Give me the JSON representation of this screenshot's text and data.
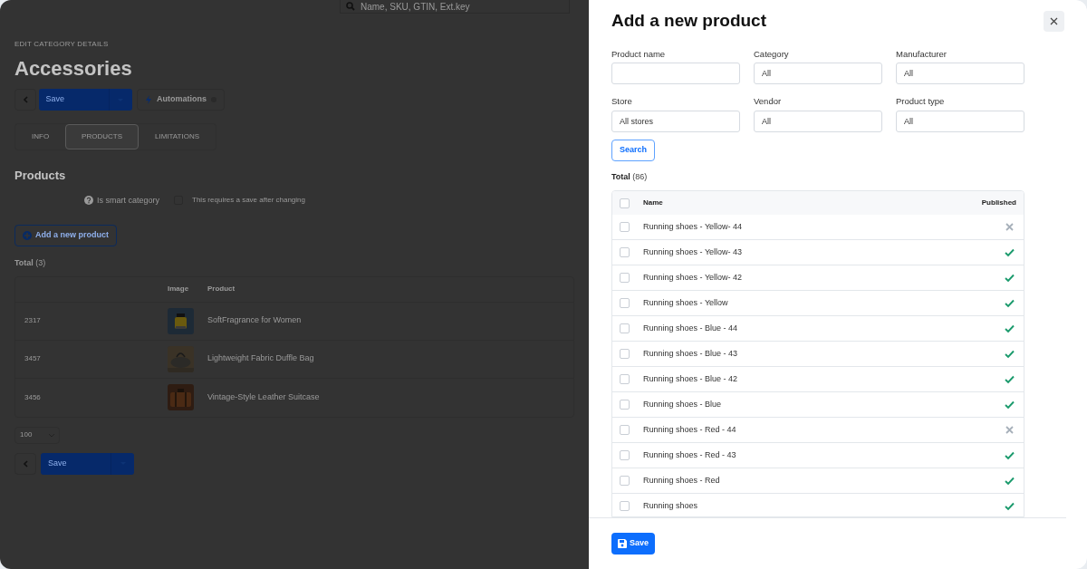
{
  "background": {
    "search": {
      "placeholder": "Name, SKU, GTIN, Ext.key"
    },
    "breadcrumb": "EDIT CATEGORY DETAILS",
    "title": "Accessories",
    "toolbar": {
      "save": "Save",
      "automations": "Automations"
    },
    "tabs": [
      {
        "label": "INFO",
        "selected": false
      },
      {
        "label": "PRODUCTS",
        "selected": true
      },
      {
        "label": "LIMITATIONS",
        "selected": false
      }
    ],
    "section_title": "Products",
    "smart_category": {
      "label": "Is smart category",
      "checked": false,
      "hint": "This requires a save after changing"
    },
    "add_button": "Add a new product",
    "total_label": "Total",
    "total_count": "(3)",
    "table": {
      "columns": [
        "Image",
        "Product"
      ],
      "rows": [
        {
          "id": "2317",
          "product": "SoftFragrance for Women"
        },
        {
          "id": "3457",
          "product": "Lightweight Fabric Duffle Bag"
        },
        {
          "id": "3456",
          "product": "Vintage-Style Leather Suitcase"
        }
      ]
    },
    "page_size": "100",
    "bottom_save": "Save"
  },
  "panel": {
    "title": "Add a new product",
    "filters": [
      {
        "label": "Product name"
      },
      {
        "label": "Category",
        "value": "All"
      },
      {
        "label": "Manufacturer",
        "value": "All"
      },
      {
        "label": "Store",
        "value": "All stores"
      },
      {
        "label": "Vendor",
        "value": "All"
      },
      {
        "label": "Product type",
        "value": "All"
      }
    ],
    "search_button": "Search",
    "total_label": "Total",
    "total_count": "(86)",
    "table": {
      "columns": [
        "Name",
        "Published"
      ],
      "header_checked": false,
      "rows": [
        {
          "name": "Running shoes - Yellow- 44",
          "checked": false,
          "published": false
        },
        {
          "name": "Running shoes - Yellow- 43",
          "checked": false,
          "published": true
        },
        {
          "name": "Running shoes - Yellow- 42",
          "checked": false,
          "published": true
        },
        {
          "name": "Running shoes - Yellow",
          "checked": false,
          "published": true
        },
        {
          "name": "Running shoes - Blue - 44",
          "checked": false,
          "published": true
        },
        {
          "name": "Running shoes - Blue - 43",
          "checked": false,
          "published": true
        },
        {
          "name": "Running shoes - Blue - 42",
          "checked": false,
          "published": true
        },
        {
          "name": "Running shoes - Blue",
          "checked": false,
          "published": true
        },
        {
          "name": "Running shoes - Red - 44",
          "checked": false,
          "published": false
        },
        {
          "name": "Running shoes - Red - 43",
          "checked": false,
          "published": true
        },
        {
          "name": "Running shoes - Red",
          "checked": false,
          "published": true
        },
        {
          "name": "Running shoes",
          "checked": false,
          "published": true
        }
      ]
    },
    "save_button": "Save"
  }
}
